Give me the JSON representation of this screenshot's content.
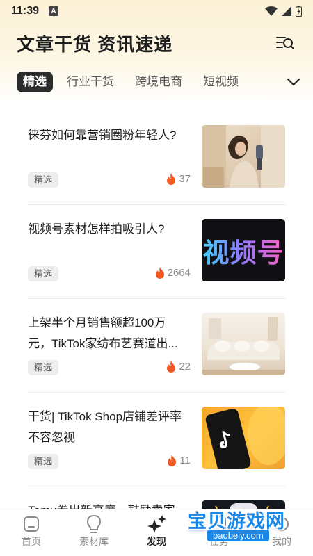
{
  "status_bar": {
    "time": "11:39",
    "notification_badge": "A"
  },
  "header": {
    "title": "文章干货 资讯速递",
    "search_icon": "list-search-icon"
  },
  "tabs": [
    {
      "label": "精选",
      "active": true
    },
    {
      "label": "行业干货",
      "active": false
    },
    {
      "label": "跨境电商",
      "active": false
    },
    {
      "label": "短视频",
      "active": false
    }
  ],
  "articles": [
    {
      "title": "徕芬如何靠营销圈粉年轻人?",
      "tag": "精选",
      "views": "37",
      "thumb": "woman-with-hair-dryer"
    },
    {
      "title": "视频号素材怎样拍吸引人?",
      "tag": "精选",
      "views": "2664",
      "thumb_text": "视频号"
    },
    {
      "title": "上架半个月销售额超100万元，TikTok家纺布艺赛道出...",
      "tag": "精选",
      "views": "22",
      "thumb": "living-room-sofa"
    },
    {
      "title": "干货| TikTok Shop店铺差评率不容忽视",
      "tag": "精选",
      "views": "11",
      "thumb": "phone-with-tiktok-logo"
    },
    {
      "title": "Temu卷出新高度，鼓励卖家",
      "tag": "",
      "views": "",
      "thumb": "game-controller"
    }
  ],
  "bottom_nav": [
    {
      "label": "首页",
      "icon": "home-icon",
      "active": false
    },
    {
      "label": "素材库",
      "icon": "lightbulb-icon",
      "active": false
    },
    {
      "label": "发现",
      "icon": "sparkle-icon",
      "active": true
    },
    {
      "label": "任务",
      "icon": "task-icon",
      "active": false
    },
    {
      "label": "我的",
      "icon": "user-icon",
      "active": false
    }
  ],
  "watermark": {
    "text": "宝贝游戏网",
    "url": "baobeiy.com"
  },
  "colors": {
    "active_tab_bg": "#2b2b2b",
    "fire": "#f15a24",
    "header_gradient": "#fbf1d6"
  }
}
